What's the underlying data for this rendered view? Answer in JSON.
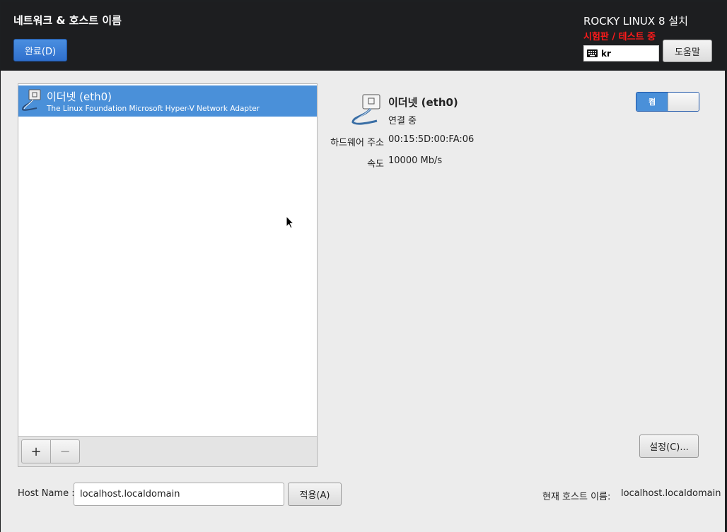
{
  "header": {
    "title": "네트워크 & 호스트 이름",
    "done_label": "완료(D)",
    "product": "ROCKY LINUX 8 설치",
    "beta": "시험판 / 테스트 중",
    "keyboard_layout": "kr",
    "help_label": "도움말"
  },
  "devices": [
    {
      "name": "이더넷 (eth0)",
      "description": "The Linux Foundation Microsoft Hyper-V Network Adapter",
      "icon": "ethernet-cable-icon"
    }
  ],
  "toolbar": {
    "add": "+",
    "remove": "−"
  },
  "detail": {
    "name": "이더넷 (eth0)",
    "status": "연결 중",
    "hw_label": "하드웨어 주소",
    "hw_value": "00:15:5D:00:FA:06",
    "speed_label": "속도",
    "speed_value": "10000 Mb/s",
    "toggle_label": "켬",
    "settings_label": "설정(C)..."
  },
  "hostname": {
    "label": "Host Name :",
    "value": "localhost.localdomain",
    "apply_label": "적용(A)",
    "current_label": "현재 호스트 이름:",
    "current_value": "localhost.localdomain"
  },
  "colors": {
    "accent": "#4a90d9",
    "header_bg": "#1d1e20",
    "beta": "#ff1a1a"
  }
}
